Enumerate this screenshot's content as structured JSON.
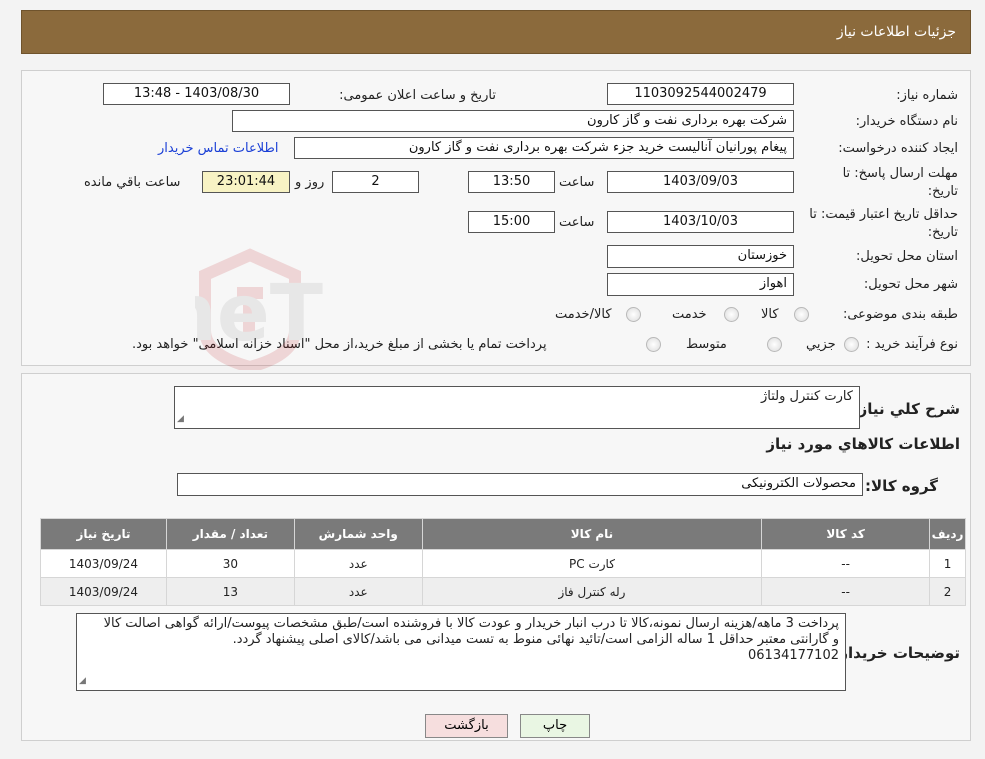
{
  "header": {
    "title": "جزئیات اطلاعات نیاز"
  },
  "need": {
    "number_label": "شماره نیاز:",
    "number": "1103092544002479",
    "announce_label": "تاریخ و ساعت اعلان عمومی:",
    "announce_value": "1403/08/30 - 13:48",
    "buyer_label": "نام دستگاه خریدار:",
    "buyer": "شرکت بهره برداری نفت و گاز کارون",
    "creator_label": "ایجاد کننده درخواست:",
    "creator": "پیغام پورانیان آنالیست خرید جزء شرکت بهره برداری نفت و گاز کارون",
    "contact_link": "اطلاعات تماس خریدار",
    "deadline_label_1": "مهلت ارسال پاسخ: تا",
    "deadline_label_2": "تاریخ:",
    "deadline_date": "1403/09/03",
    "time_label": "ساعت",
    "deadline_time": "13:50",
    "days_value": "2",
    "days_label": "روز و",
    "remaining_value": "23:01:44",
    "remaining_label": "ساعت باقي مانده",
    "validity_label_1": "حداقل تاریخ اعتبار قیمت: تا",
    "validity_label_2": "تاریخ:",
    "validity_date": "1403/10/03",
    "validity_time_label": "ساعت",
    "validity_time": "15:00",
    "province_label": "استان محل تحویل:",
    "province": "خوزستان",
    "city_label": "شهر محل تحویل:",
    "city": "اهواز",
    "category_label": "طبقه بندی موضوعی:",
    "category_options": [
      "کالا",
      "خدمت",
      "کالا/خدمت"
    ],
    "process_label": "نوع فرآیند خرید :",
    "process_options": [
      "جزیي",
      "متوسط"
    ],
    "payment_note": "پرداخت تمام یا بخشی از مبلغ خرید،از محل \"اسناد خزانه اسلامی\" خواهد بود."
  },
  "details": {
    "summary_label": "شرح کلي نیاز:",
    "summary": "کارت کنترل ولتاژ",
    "goods_heading": "اطلاعات کالاهاي مورد نياز",
    "group_label": "گروه کالا:",
    "group": "محصولات الکترونیکی",
    "table": {
      "headers": [
        "رديف",
        "کد کالا",
        "نام کالا",
        "واحد شمارش",
        "تعداد / مقدار",
        "تاریخ نیاز"
      ],
      "rows": [
        [
          "1",
          "--",
          "کارت PC",
          "عدد",
          "30",
          "1403/09/24"
        ],
        [
          "2",
          "--",
          "رله کنترل فاز",
          "عدد",
          "13",
          "1403/09/24"
        ]
      ]
    },
    "buyer_notes_label": "توضیحات خریدار:",
    "buyer_notes": "پرداخت 3 ماهه/هزینه ارسال نمونه،کالا تا درب انبار خریدار و عودت کالا با فروشنده است/طبق مشخصات پیوست/ارائه گواهی اصالت کالا و گارانتی معتبر حداقل 1 ساله الزامی است/تائید نهائی منوط به تست میدانی می باشد/کالای اصلی پیشنهاد گردد.",
    "buyer_phone": "06134177102"
  },
  "buttons": {
    "print": "چاپ",
    "back": "بازگشت"
  },
  "watermark": {
    "text": "AriaTender.neT"
  },
  "colors": {
    "header_bg": "#8b6a3c",
    "table_header_bg": "#7a7a7a",
    "print_bg": "#e9f6e3",
    "back_bg": "#f6dede",
    "link": "#1a3fd6"
  }
}
